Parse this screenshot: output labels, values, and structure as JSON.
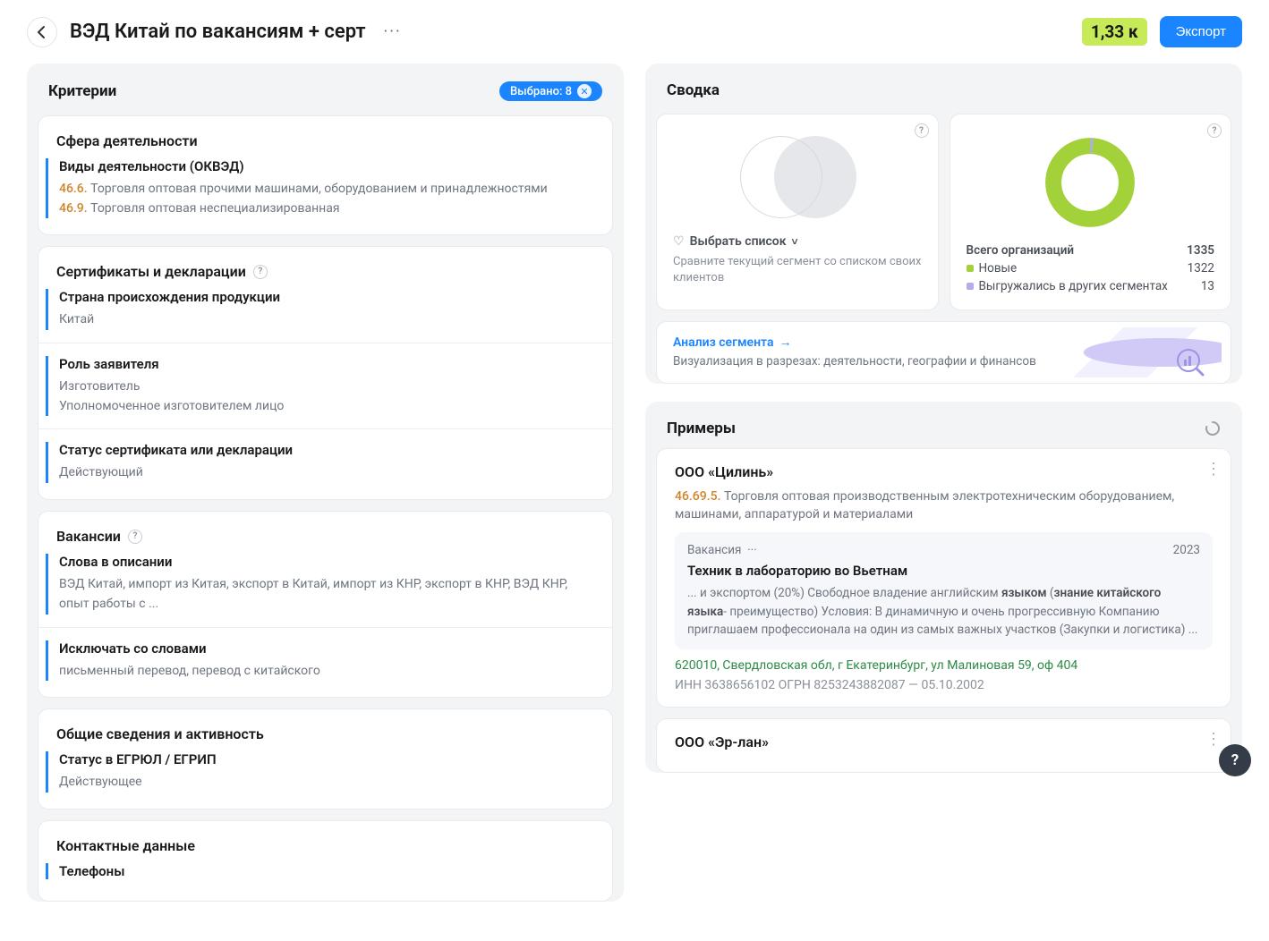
{
  "header": {
    "title": "ВЭД Китай по вакансиям + серт",
    "count_badge": "1,33 к",
    "export_label": "Экспорт"
  },
  "criteria": {
    "panel_title": "Критерии",
    "selected_chip": "Выбрано: 8",
    "groups": [
      {
        "id": "scope",
        "title": "Сфера деятельности",
        "help": false,
        "items": [
          {
            "label": "Виды деятельности (ОКВЭД)",
            "lines": [
              {
                "code": "46.6.",
                "text": "Торговля оптовая прочими машинами, оборудованием и принадлежностями"
              },
              {
                "code": "46.9.",
                "text": "Торговля оптовая неспециализированная"
              }
            ]
          }
        ]
      },
      {
        "id": "certs",
        "title": "Сертификаты и декларации",
        "help": true,
        "items": [
          {
            "label": "Страна происхождения продукции",
            "lines": [
              {
                "text": "Китай"
              }
            ]
          },
          {
            "label": "Роль заявителя",
            "lines": [
              {
                "text": "Изготовитель"
              },
              {
                "text": "Уполномоченное изготовителем лицо"
              }
            ]
          },
          {
            "label": "Статус сертификата или декларации",
            "lines": [
              {
                "text": "Действующий"
              }
            ]
          }
        ]
      },
      {
        "id": "vac",
        "title": "Вакансии",
        "help": true,
        "items": [
          {
            "label": "Слова в описании",
            "lines": [
              {
                "text": "ВЭД Китай, импорт из Китая, экспорт в Китай, импорт из КНР, экспорт в КНР, ВЭД КНР, опыт работы с ..."
              }
            ]
          },
          {
            "label": "Исключать со словами",
            "lines": [
              {
                "text": "письменный перевод, перевод с китайского"
              }
            ]
          }
        ]
      },
      {
        "id": "general",
        "title": "Общие сведения и активность",
        "help": false,
        "items": [
          {
            "label": "Статус в ЕГРЮЛ / ЕГРИП",
            "lines": [
              {
                "text": "Действующее"
              }
            ]
          }
        ]
      },
      {
        "id": "contacts",
        "title": "Контактные данные",
        "help": false,
        "items": [
          {
            "label": "Телефоны",
            "lines": []
          }
        ]
      }
    ]
  },
  "summary": {
    "panel_title": "Сводка",
    "compare": {
      "dropdown_label": "Выбрать список",
      "note": "Сравните текущий сегмент со списком своих клиентов"
    },
    "orgs": {
      "total_label": "Всего организаций",
      "total_value": "1335",
      "new_label": "Новые",
      "new_value": "1322",
      "exported_label": "Выгружались в других сегментах",
      "exported_value": "13",
      "new_color": "#a3d13a",
      "exported_color": "#b1aded"
    },
    "analysis": {
      "link": "Анализ сегмента",
      "sub": "Визуализация в разрезах: деятельности, географии и финансов"
    }
  },
  "examples": {
    "panel_title": "Примеры",
    "items": [
      {
        "name": "ООО «Цилинь»",
        "okved_code": "46.69.5.",
        "okved_text": "Торговля оптовая производственным электротехническим оборудованием, машинами, аппаратурой и материалами",
        "vacancy": {
          "tag": "Вакансия",
          "year": "2023",
          "title": "Техник в лабораторию во Вьетнам",
          "text_before": "... и экспортом (20%) Свободное владение английским ",
          "bold1": "языком",
          "text_mid1": " (",
          "bold2": "знание китайского языка",
          "text_mid2": "- преимущество) Условия: В динамичную и очень прогрессивную Компанию приглашаем профессионала на один из самых важных участков (Закупки и логистика) ..."
        },
        "address": "620010, Свердловская обл, г Екатеринбург, ул Малиновая 59, оф 404",
        "ids": "ИНН 3638656102    ОГРН 8253243882087 — 05.10.2002"
      },
      {
        "name": "ООО «Эр-лан»"
      }
    ]
  },
  "chart_data": {
    "type": "pie",
    "title": "Всего организаций",
    "series": [
      {
        "name": "Новые",
        "value": 1322,
        "color": "#a3d13a"
      },
      {
        "name": "Выгружались в других сегментах",
        "value": 13,
        "color": "#b1aded"
      }
    ],
    "total": 1335
  },
  "heart_symbol": "♡",
  "chevron_symbol": "˅",
  "right_arrow": "→",
  "ellipsis": "···"
}
